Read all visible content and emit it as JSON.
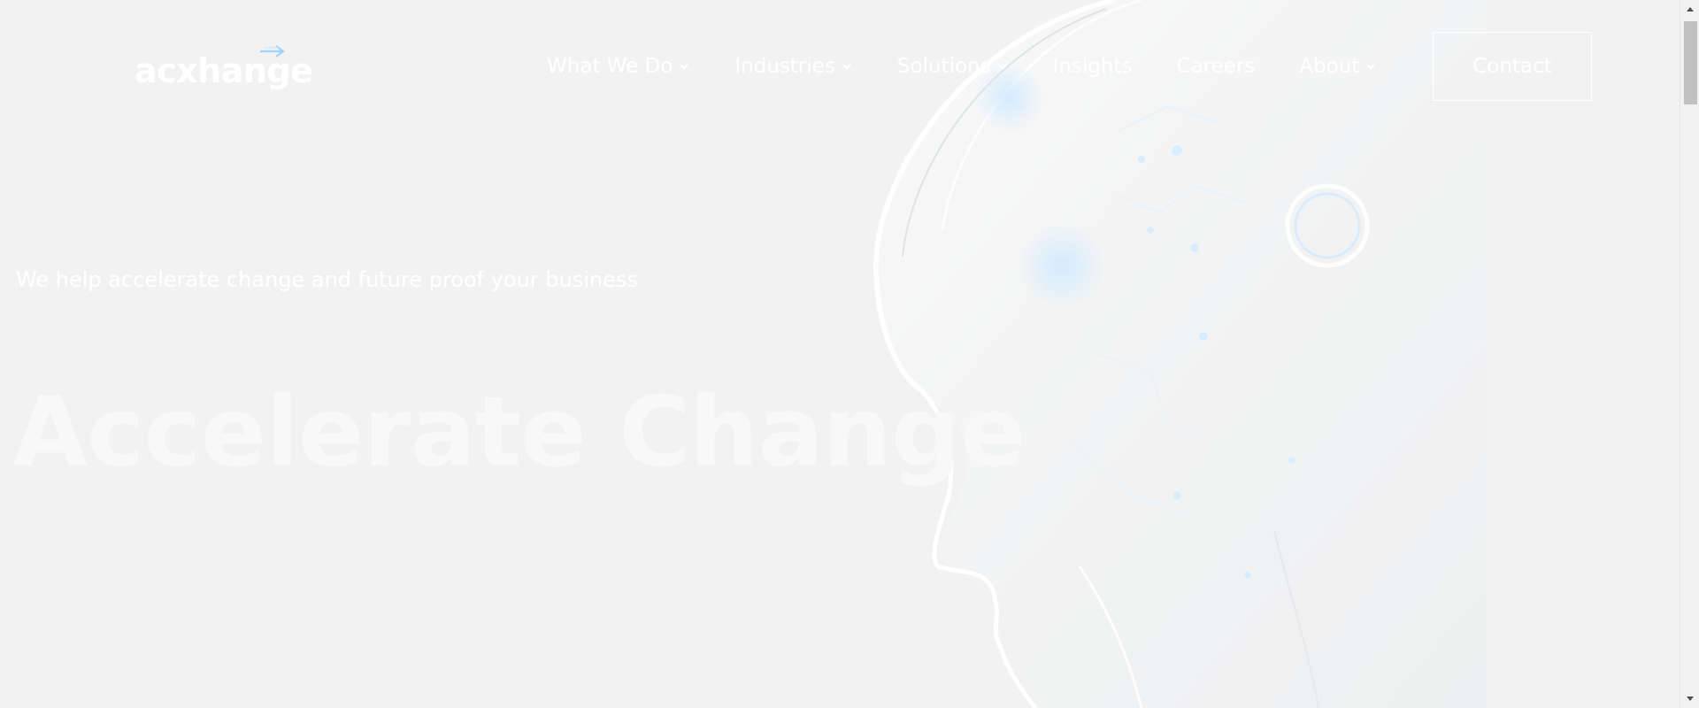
{
  "brand": {
    "logo_text": "acxhange"
  },
  "nav": {
    "items": [
      {
        "label": "What We Do",
        "has_dropdown": true
      },
      {
        "label": "Industries",
        "has_dropdown": true
      },
      {
        "label": "Solutions",
        "has_dropdown": true
      },
      {
        "label": "Insights",
        "has_dropdown": false
      },
      {
        "label": "Careers",
        "has_dropdown": false
      },
      {
        "label": "About",
        "has_dropdown": true
      }
    ],
    "contact_label": "Contact"
  },
  "hero": {
    "tagline": "We help accelerate change and future proof your business",
    "headline": "Accelerate Change"
  },
  "icons": {
    "dropdown": "chevron-down-icon",
    "logo_mark": "arrow-right-icon",
    "scroll_up": "triangle-up-icon",
    "scroll_down": "triangle-down-icon"
  },
  "colors": {
    "background": "#f2f2f2",
    "text": "#ffffff",
    "accent_glow": "#9fd4ff"
  }
}
